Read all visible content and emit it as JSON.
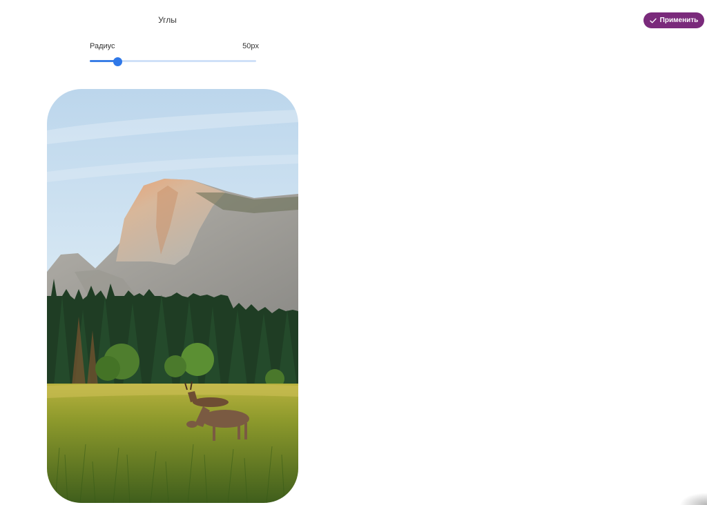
{
  "panel": {
    "title": "Углы"
  },
  "toolbar": {
    "apply_label": "Применить",
    "apply_icon": "check-icon",
    "accent_color": "#7a2a7b"
  },
  "radius": {
    "label": "Радиус",
    "value_text": "50px",
    "level": 0.165,
    "accent_color": "#2f78e8"
  },
  "preview": {
    "image": "landscape-photo-mountain-deer",
    "corner_style": "rounded"
  }
}
